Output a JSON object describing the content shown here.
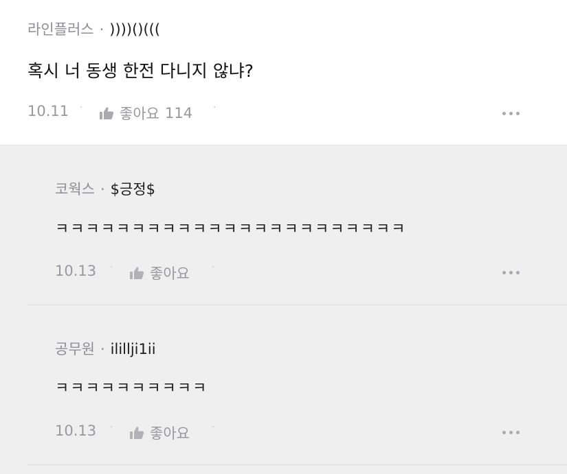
{
  "post": {
    "company": "라인플러스",
    "separator": "·",
    "nickname": "))))()(((",
    "text": "혹시 너 동생 한전 다니지 않냐?",
    "date": "10.11",
    "like_label": "좋아요",
    "like_count": "114"
  },
  "replies": [
    {
      "company": "코웍스",
      "separator": "·",
      "nickname": "$긍정$",
      "text": "ㅋㅋㅋㅋㅋㅋㅋㅋㅋㅋㅋㅋㅋㅋㅋㅋㅋㅋㅋㅋㅋㅋㅋ",
      "date": "10.13",
      "like_label": "좋아요"
    },
    {
      "company": "공무원",
      "separator": "·",
      "nickname": "ilillji1ii",
      "text": "ㅋㅋㅋㅋㅋㅋㅋㅋㅋㅋ",
      "date": "10.13",
      "like_label": "좋아요"
    }
  ],
  "icons": {
    "like": "thumbs-up-icon",
    "more": "more-horizontal-icon"
  },
  "colors": {
    "reply_background": "#efeff0",
    "meta_gray": "#8e8e93",
    "text_dark": "#111111"
  }
}
